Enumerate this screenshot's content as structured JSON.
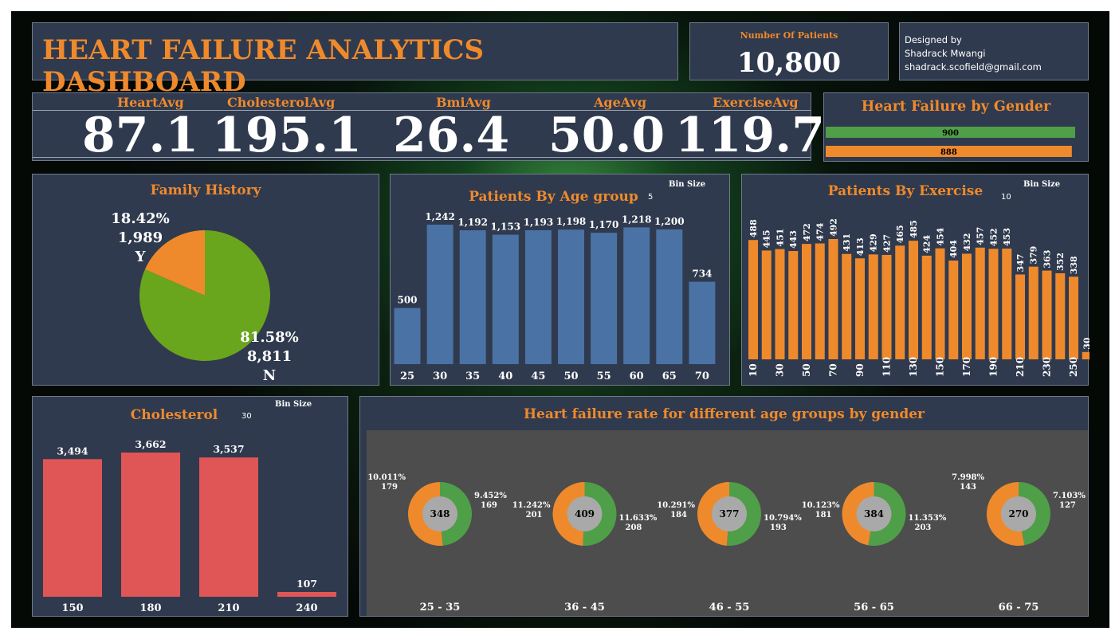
{
  "header": {
    "title": "HEART FAILURE ANALYTICS DASHBOARD",
    "patients_label": "Number Of Patients",
    "patients_value": "10,800",
    "designer_line1": "Designed by",
    "designer_line2": "Shadrack Mwangi",
    "designer_line3": "shadrack.scofield@gmail.com"
  },
  "kpis": [
    {
      "label": "HeartAvg",
      "value": "87.1"
    },
    {
      "label": "CholesterolAvg",
      "value": "195.1"
    },
    {
      "label": "BmiAvg",
      "value": "26.4"
    },
    {
      "label": "AgeAvg",
      "value": "50.0"
    },
    {
      "label": "ExerciseAvg",
      "value": "119.7"
    }
  ],
  "colors": {
    "orange": "#ef8a2c",
    "green": "#6aa51e",
    "gender_green": "#4f9e48",
    "blue": "#4a72a5",
    "red": "#e05656",
    "panel": "#303a4e",
    "donut_bg": "#4d4d4d",
    "donut_center": "#a9a9a9"
  },
  "chart_data": [
    {
      "type": "bar",
      "title": "Heart Failure by Gender",
      "orientation": "horizontal",
      "values": [
        900,
        888
      ],
      "colors": [
        "#4f9e48",
        "#ef8a2c"
      ]
    },
    {
      "type": "pie",
      "title": "Family History",
      "slices": [
        {
          "label": "Y",
          "value": 1989,
          "percent": "18.42%",
          "count": "1,989",
          "color": "#ef8a2c"
        },
        {
          "label": "N",
          "value": 8811,
          "percent": "81.58%",
          "count": "8,811",
          "color": "#6aa51e"
        }
      ]
    },
    {
      "type": "bar",
      "title": "Patients By Age group",
      "bin_label": "Bin Size",
      "bin_value": "5",
      "categories": [
        "25",
        "30",
        "35",
        "40",
        "45",
        "50",
        "55",
        "60",
        "65",
        "70"
      ],
      "values": [
        500,
        1242,
        1192,
        1153,
        1193,
        1198,
        1170,
        1218,
        1200,
        734
      ],
      "value_labels": [
        "500",
        "1,242",
        "1,192",
        "1,153",
        "1,193",
        "1,198",
        "1,170",
        "1,218",
        "1,200",
        "734"
      ],
      "ylim": [
        0,
        1300
      ]
    },
    {
      "type": "bar",
      "title": "Patients By Exercise",
      "bin_label": "Bin Size",
      "bin_value": "10",
      "categories": [
        "10",
        "20",
        "30",
        "40",
        "50",
        "60",
        "70",
        "80",
        "90",
        "100",
        "110",
        "120",
        "130",
        "140",
        "150",
        "160",
        "170",
        "180",
        "190",
        "200",
        "210",
        "220",
        "230",
        "240",
        "250"
      ],
      "tick_labels": [
        "10",
        "",
        "30",
        "",
        "50",
        "",
        "70",
        "",
        "90",
        "",
        "110",
        "",
        "130",
        "",
        "150",
        "",
        "170",
        "",
        "190",
        "",
        "210",
        "",
        "230",
        "",
        "250"
      ],
      "values": [
        488,
        445,
        451,
        443,
        472,
        474,
        492,
        431,
        413,
        429,
        427,
        465,
        485,
        424,
        454,
        404,
        432,
        457,
        452,
        453,
        347,
        379,
        363,
        352,
        338,
        30
      ],
      "ylim": [
        0,
        520
      ]
    },
    {
      "type": "bar",
      "title": "Cholesterol",
      "bin_label": "Bin Size",
      "bin_value": "30",
      "categories": [
        "150",
        "180",
        "210",
        "240"
      ],
      "values": [
        3494,
        3662,
        3537,
        107
      ],
      "value_labels": [
        "3,494",
        "3,662",
        "3,537",
        "107"
      ],
      "ylim": [
        0,
        3700
      ]
    },
    {
      "type": "pie",
      "title": "Heart failure rate for different age groups by gender",
      "groups": [
        {
          "label": "25 - 35",
          "total": "348",
          "orange": {
            "pct": "10.011%",
            "count": "179"
          },
          "green": {
            "pct": "9.452%",
            "count": "169"
          }
        },
        {
          "label": "36 - 45",
          "total": "409",
          "orange": {
            "pct": "11.242%",
            "count": "201"
          },
          "green": {
            "pct": "11.633%",
            "count": "208"
          }
        },
        {
          "label": "46 - 55",
          "total": "377",
          "orange": {
            "pct": "10.291%",
            "count": "184"
          },
          "green": {
            "pct": "10.794%",
            "count": "193"
          }
        },
        {
          "label": "56 - 65",
          "total": "384",
          "orange": {
            "pct": "10.123%",
            "count": "181"
          },
          "green": {
            "pct": "11.353%",
            "count": "203"
          }
        },
        {
          "label": "66 - 75",
          "total": "270",
          "orange": {
            "pct": "7.998%",
            "count": "143"
          },
          "green": {
            "pct": "7.103%",
            "count": "127"
          }
        }
      ]
    }
  ]
}
